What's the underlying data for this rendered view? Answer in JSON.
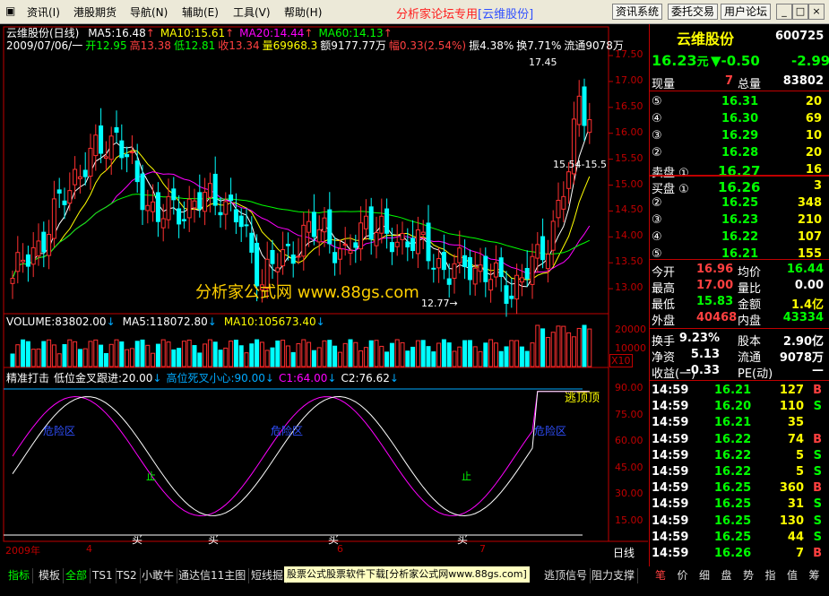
{
  "menu": {
    "items": [
      "资讯(I)",
      "港股期货",
      "导航(N)",
      "辅助(E)",
      "工具(V)",
      "帮助(H)"
    ],
    "forum_title": "分析家论坛专用",
    "forum_stock": "[云维股份]",
    "right_buttons": [
      "资讯系统",
      "委托交易",
      "用户论坛"
    ],
    "window_buttons": [
      "_",
      "□",
      "×"
    ]
  },
  "chart": {
    "header_name": "云维股份(日线)",
    "ma_labels": [
      {
        "text": "MA5:16.48",
        "color": "#ffffff"
      },
      {
        "text": "MA10:15.61",
        "color": "#ffff00"
      },
      {
        "text": "MA20:14.44",
        "color": "#ff00ff"
      },
      {
        "text": "MA60:14.13",
        "color": "#00ff00"
      }
    ],
    "info_line": [
      {
        "text": "2009/07/06/一",
        "color": "#ffffff"
      },
      {
        "text": "开12.95",
        "color": "#00ff00"
      },
      {
        "text": "高13.38",
        "color": "#ff4040"
      },
      {
        "text": "低12.81",
        "color": "#00ff00"
      },
      {
        "text": "收13.34",
        "color": "#ff4040"
      },
      {
        "text": "量69968.3",
        "color": "#ffff00"
      },
      {
        "text": "额9177.77万",
        "color": "#ffffff"
      },
      {
        "text": "幅0.33(2.54%)",
        "color": "#ff4040"
      },
      {
        "text": "振4.38%",
        "color": "#ffffff"
      },
      {
        "text": "换7.71%",
        "color": "#ffffff"
      },
      {
        "text": "流通9078万",
        "color": "#ffffff"
      }
    ],
    "price_axis": [
      "17.50",
      "17.00",
      "16.50",
      "16.00",
      "15.50",
      "15.00",
      "14.50",
      "14.00",
      "13.50",
      "13.00"
    ],
    "annotations": {
      "high": "17.45",
      "low": "12.77",
      "range": "15.54-15.5"
    },
    "watermark": "分析家公式网 www.88gs.com",
    "volume_header": [
      {
        "text": "VOLUME:83802.00",
        "color": "#ffffff"
      },
      {
        "text": "MA5:118072.80",
        "color": "#ffffff"
      },
      {
        "text": "MA10:105673.40",
        "color": "#ffff00"
      }
    ],
    "volume_axis": [
      "20000",
      "10000"
    ],
    "volume_unit": "X10",
    "indicator_header": [
      {
        "text": "精准打击",
        "color": "#ffffff"
      },
      {
        "text": "低位金叉跟进:20.00",
        "color": "#ffffff"
      },
      {
        "text": "高位死叉小心:90.00",
        "color": "#00aaff"
      },
      {
        "text": "C1:64.00",
        "color": "#ff00ff"
      },
      {
        "text": "C2:76.62",
        "color": "#ffffff"
      }
    ],
    "indicator_axis": [
      "90.00",
      "75.00",
      "60.00",
      "45.00",
      "30.00",
      "15.00"
    ],
    "indicator_labels": {
      "danger": "危险区",
      "escape": "逃顶",
      "escape_top": "逃顶顶",
      "stop": "止",
      "buy": "买"
    },
    "bottom_axis": [
      "2009年",
      "4",
      "6",
      "7"
    ],
    "period": "日线"
  },
  "panel": {
    "stock_name": "云维股份",
    "stock_code": "600725",
    "price": "16.23",
    "price_unit": "元",
    "change": "▼-0.50",
    "change_pct": "-2.99",
    "current_vol_label": "现量",
    "current_vol": "7",
    "total_vol_label": "总量",
    "total_vol": "83802",
    "sells": [
      {
        "lv": "⑤",
        "price": "16.31",
        "vol": "20"
      },
      {
        "lv": "④",
        "price": "16.30",
        "vol": "69"
      },
      {
        "lv": "③",
        "price": "16.29",
        "vol": "10"
      },
      {
        "lv": "②",
        "price": "16.28",
        "vol": "20"
      },
      {
        "lv": "卖盘 ①",
        "price": "16.27",
        "vol": "16"
      }
    ],
    "buys": [
      {
        "lv": "买盘 ①",
        "price": "16.26",
        "vol": "3"
      },
      {
        "lv": "②",
        "price": "16.25",
        "vol": "348"
      },
      {
        "lv": "③",
        "price": "16.23",
        "vol": "210"
      },
      {
        "lv": "④",
        "price": "16.22",
        "vol": "107"
      },
      {
        "lv": "⑤",
        "price": "16.21",
        "vol": "155"
      }
    ],
    "stats": [
      {
        "l1": "今开",
        "v1": "16.96",
        "c1": "#ff4040",
        "l2": "均价",
        "v2": "16.44",
        "c2": "#00ff00"
      },
      {
        "l1": "最高",
        "v1": "17.00",
        "c1": "#ff4040",
        "l2": "量比",
        "v2": "0.00",
        "c2": "#ffffff"
      },
      {
        "l1": "最低",
        "v1": "15.83",
        "c1": "#00ff00",
        "l2": "金额",
        "v2": "1.4亿",
        "c2": "#ffff00"
      },
      {
        "l1": "外盘",
        "v1": "40468",
        "c1": "#ff4040",
        "l2": "内盘",
        "v2": "43334",
        "c2": "#00ff00"
      }
    ],
    "stats2": [
      {
        "l1": "换手",
        "v1": "9.23%",
        "l2": "股本",
        "v2": "2.90亿"
      },
      {
        "l1": "净资",
        "v1": "5.13",
        "l2": "流通",
        "v2": "9078万"
      },
      {
        "l1": "收益(一)",
        "v1": "-0.33",
        "l2": "PE(动)",
        "v2": "—"
      }
    ],
    "ticks": [
      {
        "t": "14:59",
        "p": "16.21",
        "v": "127",
        "bs": "B"
      },
      {
        "t": "14:59",
        "p": "16.20",
        "v": "110",
        "bs": "S"
      },
      {
        "t": "14:59",
        "p": "16.21",
        "v": "35",
        "bs": ""
      },
      {
        "t": "14:59",
        "p": "16.22",
        "v": "74",
        "bs": "B"
      },
      {
        "t": "14:59",
        "p": "16.22",
        "v": "5",
        "bs": "S"
      },
      {
        "t": "14:59",
        "p": "16.22",
        "v": "5",
        "bs": "S"
      },
      {
        "t": "14:59",
        "p": "16.25",
        "v": "360",
        "bs": "B"
      },
      {
        "t": "14:59",
        "p": "16.25",
        "v": "31",
        "bs": "S"
      },
      {
        "t": "14:59",
        "p": "16.25",
        "v": "130",
        "bs": "S"
      },
      {
        "t": "14:59",
        "p": "16.25",
        "v": "44",
        "bs": "S"
      },
      {
        "t": "14:59",
        "p": "16.26",
        "v": "7",
        "bs": "B"
      }
    ]
  },
  "bottom_tabs": [
    "指标",
    "模板",
    "全部",
    "TS1",
    "TS2",
    "小敢牛",
    "通达信11主图",
    "短线掘"
  ],
  "bottom_banner": "股票公式股票软件下载[分析家公式网www.88gs.com]",
  "bottom_tabs_right": [
    "逃顶信号",
    "阻力支撑"
  ],
  "right_tabs": [
    "笔",
    "价",
    "细",
    "盘",
    "势",
    "指",
    "值",
    "筹"
  ]
}
